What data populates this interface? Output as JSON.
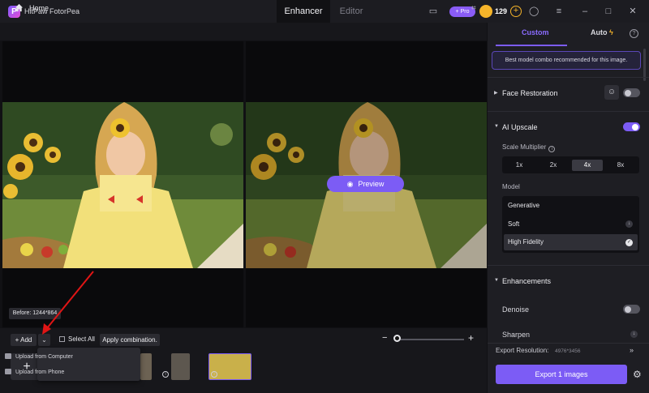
{
  "app": {
    "title": "HitPaw FotorPea",
    "logo_letter": "P"
  },
  "tabs": {
    "enhancer": "Enhancer",
    "editor": "Editor"
  },
  "titlebar": {
    "pro_label": "+ Pro",
    "credits": "129",
    "plus": "+"
  },
  "header": {
    "home_label": "Home"
  },
  "canvas": {
    "preview_label": "Preview",
    "before_label": "Before: 1244*864"
  },
  "toolbar": {
    "add_label": "+ Add",
    "select_all_label": "Select All",
    "apply_label": "Apply combination.",
    "zoom_minus": "−",
    "zoom_plus": "+"
  },
  "dropdown": {
    "items": [
      "Upload from Computer",
      "Upload from Phone"
    ]
  },
  "sidebar": {
    "tabs": {
      "custom": "Custom",
      "auto": "Auto"
    },
    "hint": "Best model combo recommended for this image.",
    "face_restoration": {
      "label": "Face Restoration",
      "enabled": false
    },
    "ai_upscale": {
      "label": "AI Upscale",
      "enabled": true,
      "scale_label": "Scale Multiplier",
      "scales": [
        "1x",
        "2x",
        "4x",
        "8x"
      ],
      "selected_scale": "4x",
      "model_label": "Model",
      "models": [
        "Generative",
        "Soft",
        "High Fidelity"
      ],
      "selected_model": "High Fidelity"
    },
    "enhancements": {
      "label": "Enhancements",
      "denoise_label": "Denoise",
      "denoise_enabled": false,
      "sharpen_label": "Sharpen"
    },
    "export": {
      "resolution_label": "Export Resolution:",
      "resolution_value": "4976*3456",
      "button_label": "Export 1 images"
    }
  },
  "colors": {
    "accent": "#7c5cf5",
    "gold": "#f5b42a",
    "annotation": "#e01515"
  }
}
